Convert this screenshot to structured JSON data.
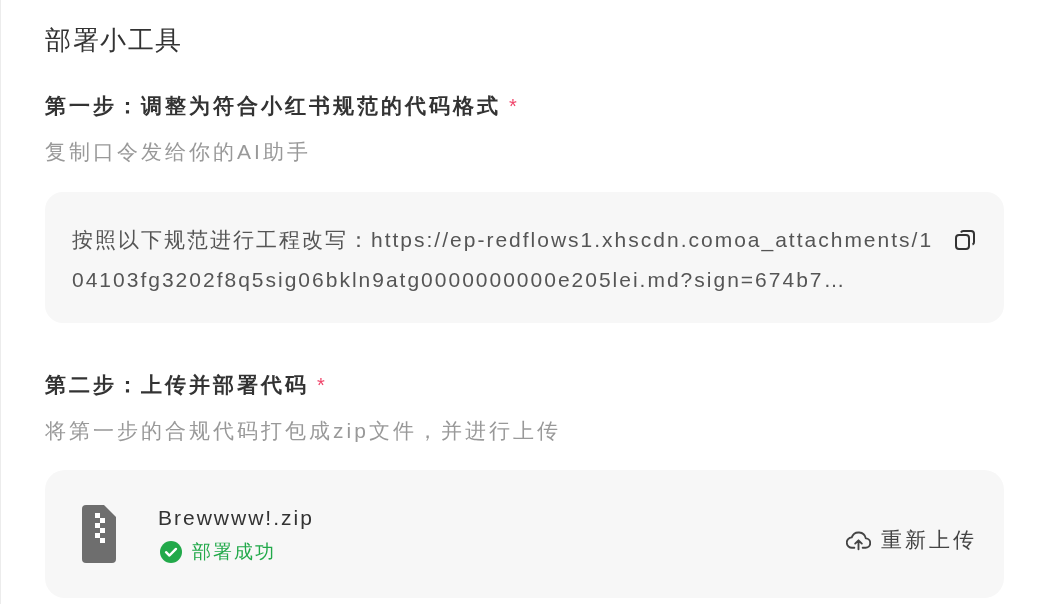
{
  "title": "部署小工具",
  "steps": [
    {
      "kind": "copy",
      "label": "第一步：调整为符合小红书规范的代码格式",
      "required_mark": "*",
      "description": "复制口令发给你的AI助手",
      "command": "按照以下规范进行工程改写：https://ep-redflows1.xhscdn.comoa_attachments/104103fg3202f8q5sig06bkln9atg0000000000e205lei.md?sign=674b7…"
    },
    {
      "kind": "upload",
      "label": "第二步：上传并部署代码",
      "required_mark": "*",
      "description": "将第一步的合规代码打包成zip文件，并进行上传",
      "file": {
        "name": "Brewwww!.zip",
        "status": {
          "kind": "success",
          "text": "部署成功"
        }
      },
      "action": "重新上传"
    }
  ]
}
